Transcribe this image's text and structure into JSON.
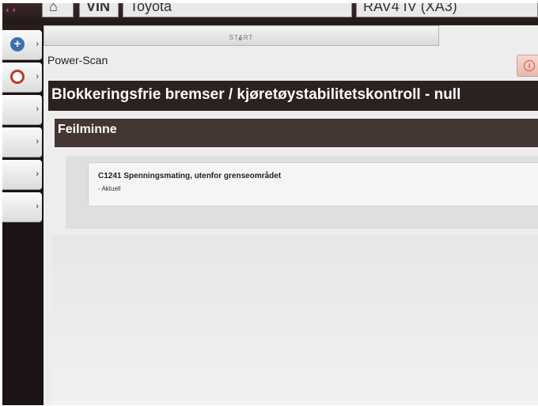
{
  "topbar": {
    "vin_label": "VIN",
    "make_value": "Toyota",
    "model_value": "RAV4 IV (XA3)"
  },
  "sidebar": {
    "items": [
      {
        "icon": "plus-icon"
      },
      {
        "icon": "stop-icon"
      },
      {
        "icon": ""
      },
      {
        "icon": ""
      },
      {
        "icon": ""
      },
      {
        "icon": ""
      }
    ]
  },
  "tab": {
    "label": "START"
  },
  "panel": {
    "title": "Power-Scan",
    "section_title": "Blokkeringsfrie bremser / kjøretøystabilitetskontroll - null",
    "subsection_title": "Feilminne"
  },
  "dtc": {
    "code_text": "C1241 Spenningsmating, utenfor grenseområdet",
    "status": "- Aktuell"
  },
  "colors": {
    "header_dark": "#2b2220",
    "subheader": "#433633",
    "accent_red": "#c0392b",
    "plus_blue": "#3f6fb0"
  }
}
